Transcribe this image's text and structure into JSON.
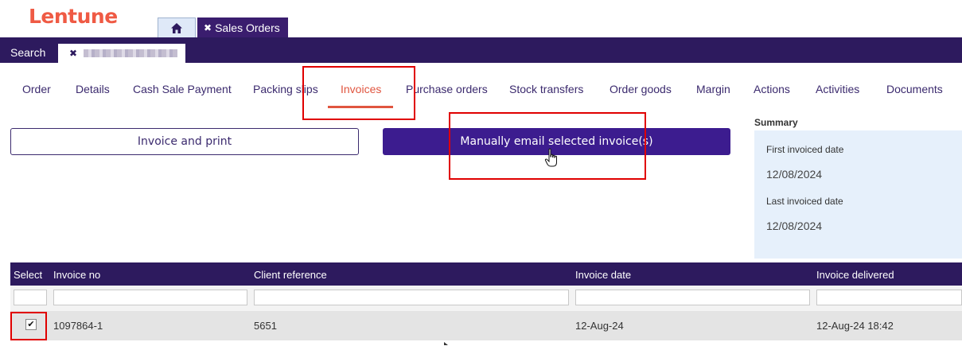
{
  "app": {
    "logo_text": "Lentune",
    "brand_color": "#ef5a44",
    "nav_color": "#2d1a5e"
  },
  "top_tabs": {
    "home_icon": "home-icon",
    "sales_orders_label": "Sales Orders",
    "close_glyph": "✖"
  },
  "navbar": {
    "search_label": "Search",
    "record_tab_close": "✖"
  },
  "subtabs": {
    "items": [
      "Order",
      "Details",
      "Cash Sale Payment",
      "Packing slips",
      "Invoices",
      "Purchase orders",
      "Stock transfers",
      "Order goods",
      "Margin",
      "Actions",
      "Activities",
      "Documents"
    ],
    "active": "Invoices"
  },
  "buttons": {
    "invoice_and_print": "Invoice and print",
    "manually_email": "Manually email selected invoice(s)"
  },
  "summary": {
    "title": "Summary",
    "first_invoiced_label": "First invoiced date",
    "first_invoiced_value": "12/08/2024",
    "last_invoiced_label": "Last invoiced date",
    "last_invoiced_value": "12/08/2024"
  },
  "table": {
    "headers": [
      "Select",
      "Invoice no",
      "Client reference",
      "Invoice date",
      "Invoice delivered"
    ],
    "rows": [
      {
        "selected": true,
        "check_glyph": "✔",
        "invoice_no": "1097864-1",
        "client_reference": "5651",
        "invoice_date": "12-Aug-24",
        "invoice_delivered": "12-Aug-24 18:42"
      }
    ]
  }
}
